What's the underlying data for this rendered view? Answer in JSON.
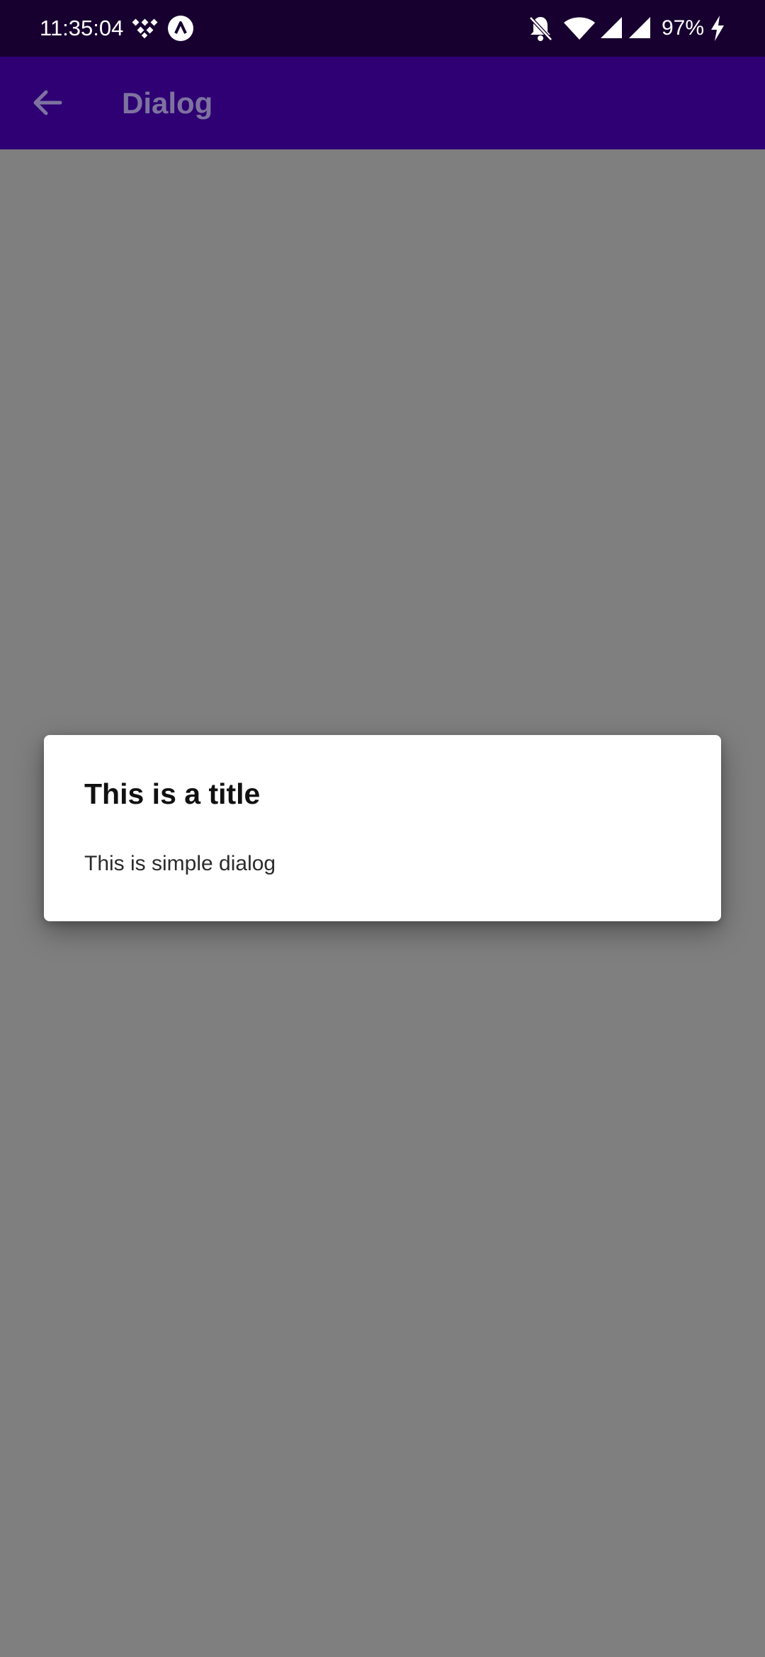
{
  "status_bar": {
    "time": "11:35:04",
    "battery": "97%",
    "icons": [
      "dots-grid-icon",
      "app-circle-icon",
      "bell-muted-icon",
      "wifi-icon",
      "signal-icon",
      "signal-icon",
      "charging-bolt-icon"
    ]
  },
  "app_bar": {
    "title": "Dialog",
    "back_icon": "arrow-left-icon",
    "background": "#2e0073",
    "title_color": "#7e73a0"
  },
  "dialog": {
    "title": "This is a title",
    "message": "This is simple dialog"
  },
  "colors": {
    "status_bar": "#17002f",
    "scrim": "#7f7f7f",
    "dialog_bg": "#ffffff"
  }
}
